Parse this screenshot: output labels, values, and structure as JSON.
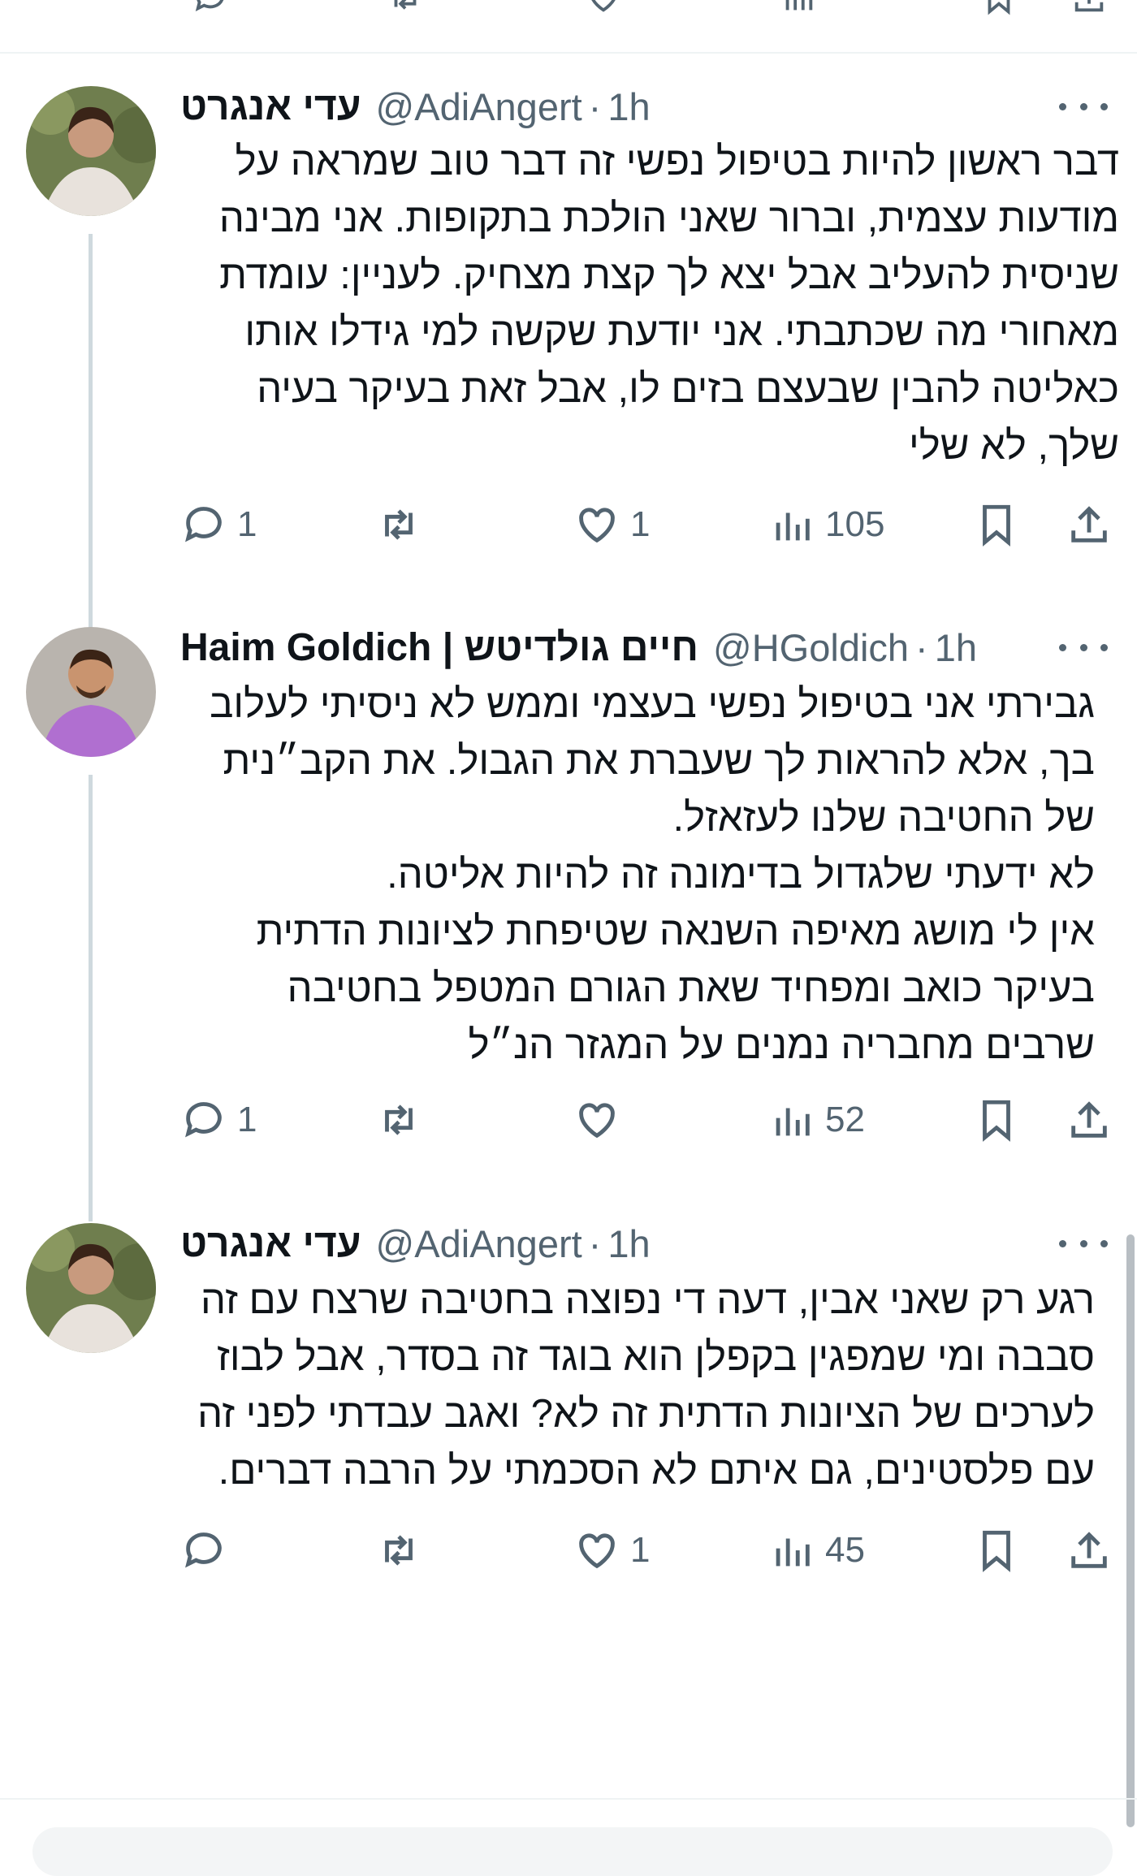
{
  "colors": {
    "text": "#0f1419",
    "secondary": "#536471",
    "thread_line": "#cfd9de",
    "divider": "#eff3f4"
  },
  "tweets": [
    {
      "name": "עדי אנגרט",
      "handle": "@AdiAngert",
      "time": "1h",
      "text": "דבר ראשון להיות בטיפול נפשי זה דבר טוב שמראה על\nמודעות עצמית, וברור שאני הולכת בתקופות. אני מבינה\nשניסית להעליב אבל יצא לך קצת מצחיק. לעניין: עומדת\nמאחורי מה שכתבתי. אני יודעת שקשה למי גידלו אותו\nכאליטה להבין שבעצם בזים לו, אבל זאת בעיקר בעיה\nשלך, לא שלי",
      "replies": "1",
      "retweets": "",
      "likes": "1",
      "views": "105",
      "avatar_icon": "avatar-woman"
    },
    {
      "name": "Haim Goldich | חיים גולדיטש",
      "handle": "@HGoldich",
      "time": "1h",
      "text": "גבירתי אני בטיפול נפשי בעצמי וממש לא ניסיתי לעלוב\nבך, אלא להראות לך שעברת את הגבול. את הקב״נית\nשל החטיבה שלנו לעזאזל.\nלא ידעתי שלגדול בדימונה זה להיות אליטה.\nאין לי מושג מאיפה השנאה שטיפחת לציונות הדתית\nבעיקר כואב ומפחיד שאת הגורם המטפל בחטיבה\nשרבים מחבריה נמנים על המגזר הנ״ל",
      "replies": "1",
      "retweets": "",
      "likes": "",
      "views": "52",
      "avatar_icon": "avatar-man"
    },
    {
      "name": "עדי אנגרט",
      "handle": "@AdiAngert",
      "time": "1h",
      "text": "רגע רק שאני אבין, דעה די נפוצה בחטיבה שרצח עם זה\nסבבה ומי שמפגין בקפלן הוא בוגד זה בסדר, אבל לבוז\nלערכים של הציונות הדתית זה לא? ואגב עבדתי לפני זה\nעם פלסטינים, גם איתם לא הסכמתי על הרבה דברים.",
      "replies": "",
      "retweets": "",
      "likes": "1",
      "views": "45",
      "avatar_icon": "avatar-woman"
    }
  ]
}
